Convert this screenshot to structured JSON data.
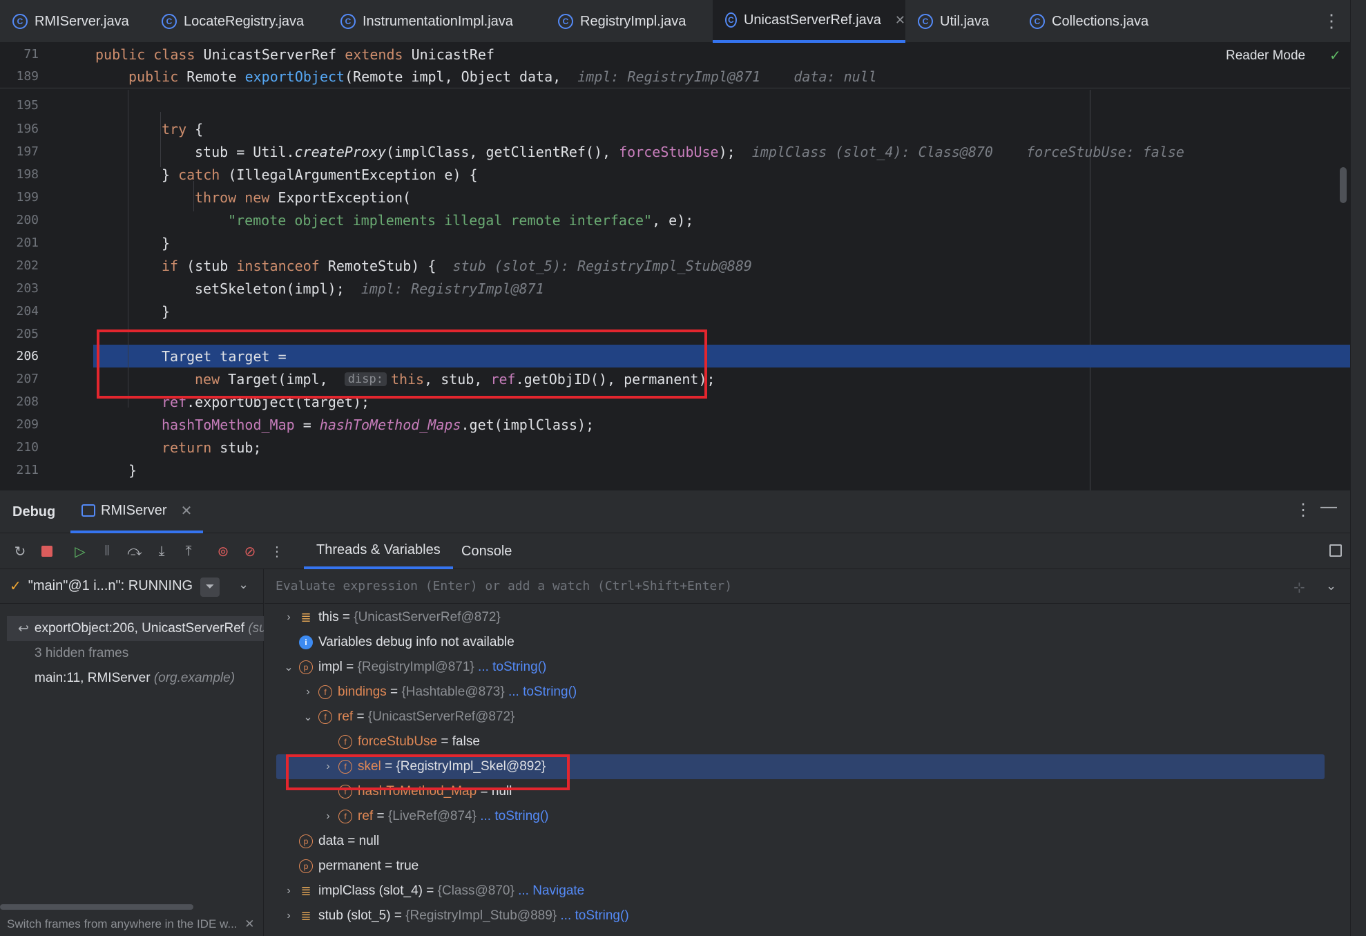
{
  "tabs": [
    {
      "label": "RMIServer.java",
      "active": false
    },
    {
      "label": "LocateRegistry.java",
      "active": false
    },
    {
      "label": "InstrumentationImpl.java",
      "active": false
    },
    {
      "label": "RegistryImpl.java",
      "active": false
    },
    {
      "label": "UnicastServerRef.java",
      "active": true
    },
    {
      "label": "Util.java",
      "active": false
    },
    {
      "label": "Collections.java",
      "active": false
    }
  ],
  "editor": {
    "reader_mode": "Reader Mode",
    "sticky": [
      {
        "ln": "71",
        "code": "public class UnicastServerRef extends UnicastRef"
      },
      {
        "ln": "189",
        "code": "public Remote exportObject(Remote impl, Object data,",
        "hint": "impl: RegistryImpl@871    data: null"
      }
    ],
    "lines": [
      {
        "ln": "195"
      },
      {
        "ln": "196",
        "code": "try {"
      },
      {
        "ln": "197",
        "code": "stub = Util.createProxy(implClass, getClientRef(), forceStubUse);",
        "hint": "implClass (slot_4): Class@870    forceStubUse: false"
      },
      {
        "ln": "198",
        "code": "} catch (IllegalArgumentException e) {"
      },
      {
        "ln": "199",
        "code": "throw new ExportException("
      },
      {
        "ln": "200",
        "code": "\"remote object implements illegal remote interface\", e);"
      },
      {
        "ln": "201",
        "code": "}"
      },
      {
        "ln": "202",
        "code": "if (stub instanceof RemoteStub) {",
        "hint": "stub (slot_5): RegistryImpl_Stub@889"
      },
      {
        "ln": "203",
        "code": "setSkeleton(impl);",
        "hint": "impl: RegistryImpl@871"
      },
      {
        "ln": "204",
        "code": "}"
      },
      {
        "ln": "205"
      },
      {
        "ln": "206",
        "code": "Target target ="
      },
      {
        "ln": "207",
        "code": "new Target(impl, disp: this, stub, ref.getObjID(), permanent);",
        "hint_pill": "disp:"
      },
      {
        "ln": "208",
        "code": "ref.exportObject(target);"
      },
      {
        "ln": "209",
        "code": "hashToMethod_Map = hashToMethod_Maps.get(implClass);"
      },
      {
        "ln": "210",
        "code": "return stub;"
      },
      {
        "ln": "211",
        "code": "}"
      }
    ]
  },
  "debug": {
    "title": "Debug",
    "session_tab": "RMIServer",
    "tabs": {
      "threads": "Threads & Variables",
      "console": "Console"
    },
    "thread": "\"main\"@1 i...n\": RUNNING",
    "frames": [
      {
        "method": "exportObject:206, UnicastServerRef",
        "pkg": "(su"
      },
      {
        "method": "3 hidden frames",
        "pkg": ""
      },
      {
        "method": "main:11, RMIServer",
        "pkg": "(org.example)"
      }
    ],
    "tip": "Switch frames from anywhere in the IDE w...",
    "eval_placeholder": "Evaluate expression (Enter) or add a watch (Ctrl+Shift+Enter)",
    "variables": [
      {
        "name": "this",
        "eq": " = ",
        "value": "{UnicastServerRef@872}",
        "link": ""
      },
      {
        "name": "Variables debug info not available",
        "eq": "",
        "value": "",
        "link": ""
      },
      {
        "name": "impl",
        "eq": " = ",
        "value": "{RegistryImpl@871}",
        "link": "... toString()"
      },
      {
        "name": "bindings",
        "eq": " = ",
        "value": "{Hashtable@873}",
        "link": "... toString()"
      },
      {
        "name": "ref",
        "eq": " = ",
        "value": "{UnicastServerRef@872}",
        "link": ""
      },
      {
        "name": "forceStubUse",
        "eq": " = ",
        "value": "false",
        "link": ""
      },
      {
        "name": "skel",
        "eq": " = ",
        "value": "{RegistryImpl_Skel@892}",
        "link": ""
      },
      {
        "name": "hashToMethod_Map",
        "eq": " = ",
        "value": "null",
        "link": ""
      },
      {
        "name": "ref",
        "eq": " = ",
        "value": "{LiveRef@874}",
        "link": "... toString()"
      },
      {
        "name": "data",
        "eq": " = ",
        "value": "null",
        "link": ""
      },
      {
        "name": "permanent",
        "eq": " = ",
        "value": "true",
        "link": ""
      },
      {
        "name": "implClass (slot_4)",
        "eq": " = ",
        "value": "{Class@870}",
        "link": "... Navigate"
      },
      {
        "name": "stub (slot_5)",
        "eq": " = ",
        "value": "{RegistryImpl_Stub@889}",
        "link": "... toString()"
      }
    ]
  }
}
